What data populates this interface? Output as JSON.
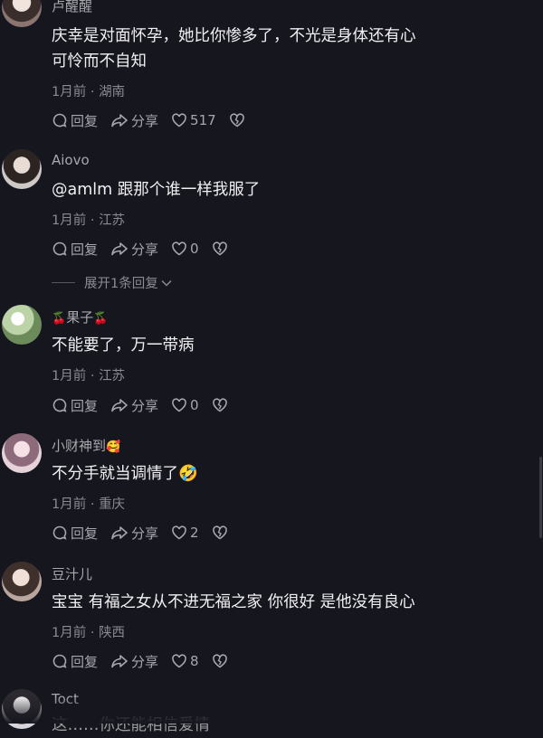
{
  "comments": [
    {
      "username": "卢醒醒",
      "text_lines": [
        "庆幸是对面怀孕，她比你惨多了，不光是身体还有心",
        "可怜而不自知"
      ],
      "time": "1月前",
      "location": "湖南",
      "reply_label": "回复",
      "share_label": "分享",
      "likes": "517"
    },
    {
      "username": "Aiovo",
      "text_lines": [
        "@amlm 跟那个谁一样我服了"
      ],
      "time": "1月前",
      "location": "江苏",
      "reply_label": "回复",
      "share_label": "分享",
      "likes": "0",
      "expand_label": "展开1条回复"
    },
    {
      "username": "果子",
      "username_emoji": "🍒",
      "text_lines": [
        "不能要了，万一带病"
      ],
      "time": "1月前",
      "location": "江苏",
      "reply_label": "回复",
      "share_label": "分享",
      "likes": "0"
    },
    {
      "username": "小财神到",
      "username_emoji": "🥰",
      "text_lines": [
        "不分手就当调情了"
      ],
      "text_emoji": "🤣",
      "time": "1月前",
      "location": "重庆",
      "reply_label": "回复",
      "share_label": "分享",
      "likes": "2"
    },
    {
      "username": "豆汁儿",
      "text_lines": [
        "宝宝 有福之女从不进无福之家 你很好 是他没有良心"
      ],
      "time": "1月前",
      "location": "陕西",
      "reply_label": "回复",
      "share_label": "分享",
      "likes": "8"
    },
    {
      "username": "Toct",
      "text_lines": [
        "这……你还能相信爱情"
      ]
    }
  ],
  "icons": {
    "reply": "reply-icon",
    "share": "share-icon",
    "like": "heart-icon",
    "dislike": "broken-heart-icon",
    "expand": "chevron-down-icon"
  },
  "colors": {
    "background": "#16161e",
    "primary_text": "#f0f0f3",
    "secondary_text": "#8a8a93"
  }
}
